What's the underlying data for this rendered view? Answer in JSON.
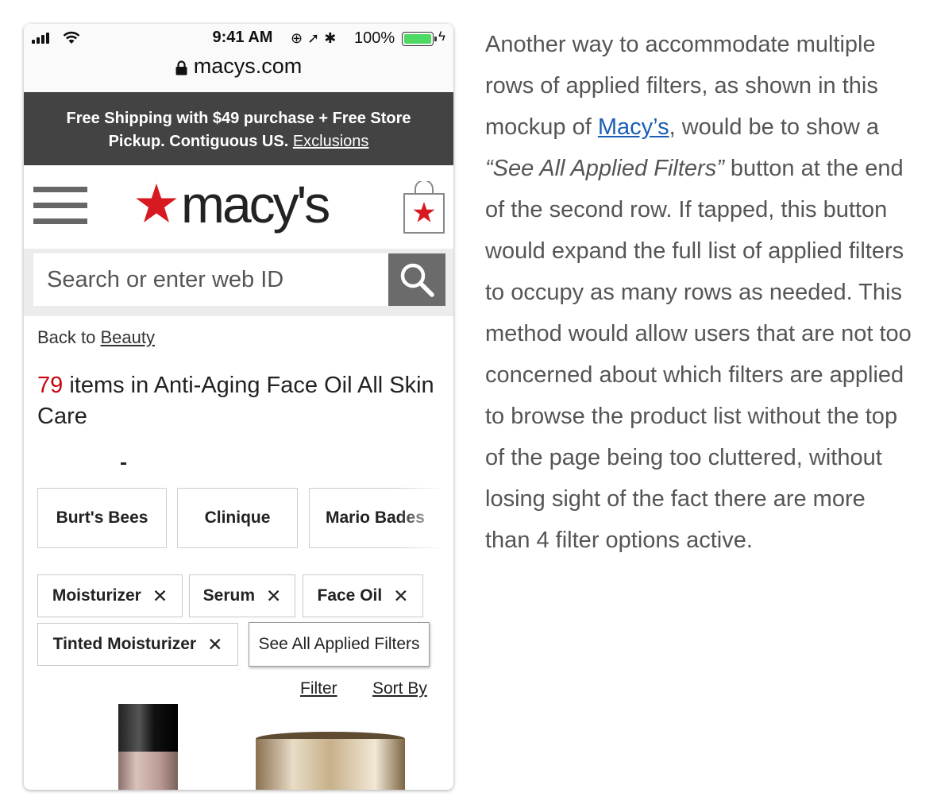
{
  "status_bar": {
    "time": "9:41 AM",
    "battery": "100%",
    "url": "macys.com"
  },
  "promo": {
    "line1": "Free Shipping with $49 purchase + Free Store",
    "line2": "Pickup. Contiguous US.",
    "link": "Exclusions"
  },
  "header": {
    "logo_text": "macy's",
    "logo_color": "#d71921"
  },
  "search": {
    "placeholder": "Search or enter web ID"
  },
  "breadcrumb": {
    "prefix": "Back to",
    "link": "Beauty"
  },
  "results": {
    "count": "79",
    "text": "items in Anti-Aging Face Oil All Skin Care"
  },
  "brand_filters": [
    "Burt's Bees",
    "Clinique",
    "Mario Bades"
  ],
  "applied_filters": [
    "Moisturizer",
    "Serum",
    "Face Oil",
    "Tinted Moisturizer"
  ],
  "remove_glyph": "✕",
  "see_all_label": "See All Applied Filters",
  "actions": {
    "filter": "Filter",
    "sort": "Sort By"
  },
  "article": {
    "p1": "Another way to accommodate multiple rows of applied filters, as shown in this mockup of",
    "link": "Macy’s",
    "p2": ", would be to show a",
    "quote": "“See All Applied Filters”",
    "p3": "button at the end of the second row. If tapped, this button would expand the full list of applied filters to occupy as many rows as needed. This method would allow users that are not too concerned about which filters are applied to browse the product list without the top of the page being too cluttered, without losing sight of the fact there are more than 4 filter options active."
  },
  "colors": {
    "promo_bg": "#434343",
    "brand_red": "#d71921",
    "count_red": "#c40812",
    "link_blue": "#1a5fb4",
    "search_button": "#6b6b6b"
  }
}
